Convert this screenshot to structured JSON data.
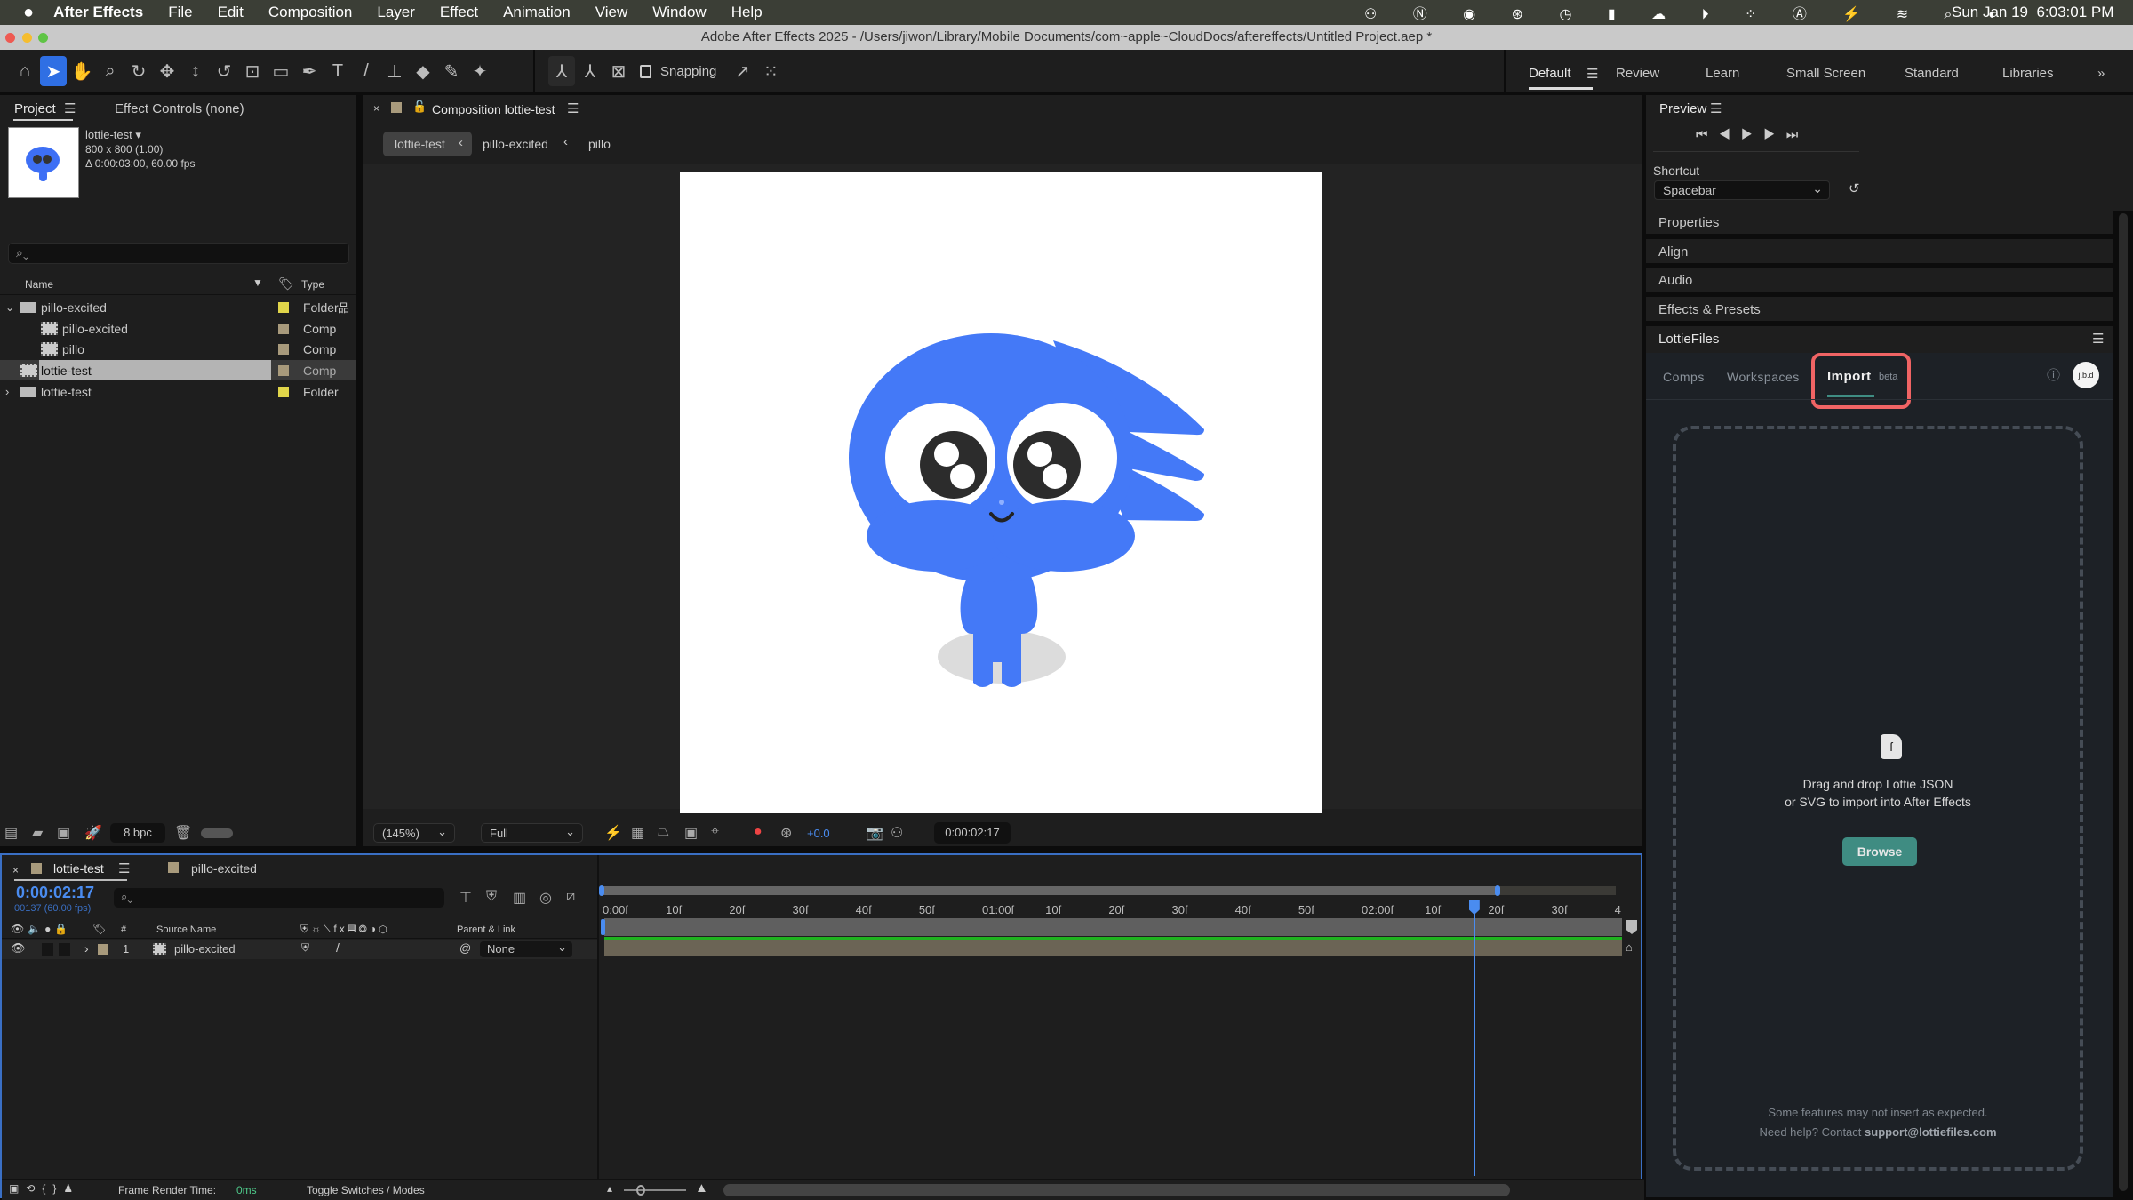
{
  "menubar": {
    "app": "After Effects",
    "items": [
      "File",
      "Edit",
      "Composition",
      "Layer",
      "Effect",
      "Animation",
      "View",
      "Window",
      "Help"
    ],
    "clock": "Sun Jan 19  6:03:01 PM"
  },
  "window": {
    "title": "Adobe After Effects 2025 - /Users/jiwon/Library/Mobile Documents/com~apple~CloudDocs/aftereffects/Untitled Project.aep *"
  },
  "toolbar": {
    "snapping": "Snapping",
    "workspaces": [
      "Default",
      "Review",
      "Learn",
      "Small Screen",
      "Standard",
      "Libraries"
    ],
    "active_workspace": "Default"
  },
  "project": {
    "tab": "Project",
    "effect_controls": "Effect Controls (none)",
    "selected_name": "lottie-test ▾",
    "dimensions": "800 x 800 (1.00)",
    "duration": "Δ 0:00:03:00, 60.00 fps",
    "col_name": "Name",
    "col_type": "Type",
    "bpc": "8 bpc",
    "items": [
      {
        "name": "pillo-excited",
        "type": "Folder",
        "color": "#e0d54a"
      },
      {
        "name": "pillo-excited",
        "type": "Comp",
        "color": "#a89a7c"
      },
      {
        "name": "pillo",
        "type": "Comp",
        "color": "#a89a7c"
      },
      {
        "name": "lottie-test",
        "type": "Comp",
        "color": "#a89a7c"
      },
      {
        "name": "lottie-test",
        "type": "Folder",
        "color": "#e0d54a"
      }
    ]
  },
  "composition": {
    "tab": "Composition lottie-test",
    "breadcrumbs": [
      "lottie-test",
      "pillo-excited",
      "pillo"
    ],
    "zoom": "(145%)",
    "resolution": "Full",
    "exposure": "+0.0",
    "timecode": "0:00:02:17"
  },
  "preview": {
    "title": "Preview",
    "shortcut_label": "Shortcut",
    "shortcut": "Spacebar"
  },
  "sections": [
    "Properties",
    "Align",
    "Audio",
    "Effects & Presets",
    "LottieFiles"
  ],
  "lottiefiles": {
    "tabs": [
      "Comps",
      "Workspaces",
      "Import"
    ],
    "active_tab": "Import",
    "beta": "beta",
    "avatar": "j.b.d",
    "drop_line1": "Drag and drop Lottie JSON",
    "drop_line2": "or SVG to import into After Effects",
    "browse": "Browse",
    "note": "Some features may not insert as expected.",
    "help": "Need help? Contact",
    "email": "support@lottiefiles.com",
    "accent": "#3f8c82",
    "highlight": "#f06464"
  },
  "timeline": {
    "tab": "lottie-test",
    "tab2": "pillo-excited",
    "time": "0:00:02:17",
    "frames": "00137 (60.00 fps)",
    "col_source": "Source Name",
    "col_num": "#",
    "col_parent": "Parent & Link",
    "layer": {
      "num": "1",
      "name": "pillo-excited",
      "parent": "None"
    },
    "ruler": [
      "0:00f",
      "10f",
      "20f",
      "30f",
      "40f",
      "50f",
      "01:00f",
      "10f",
      "20f",
      "30f",
      "40f",
      "50f",
      "02:00f",
      "10f",
      "20f",
      "30f",
      "4"
    ],
    "playhead_seconds": 2.283,
    "render_label": "Frame Render Time:",
    "render_value": "0ms",
    "toggle": "Toggle Switches / Modes"
  }
}
